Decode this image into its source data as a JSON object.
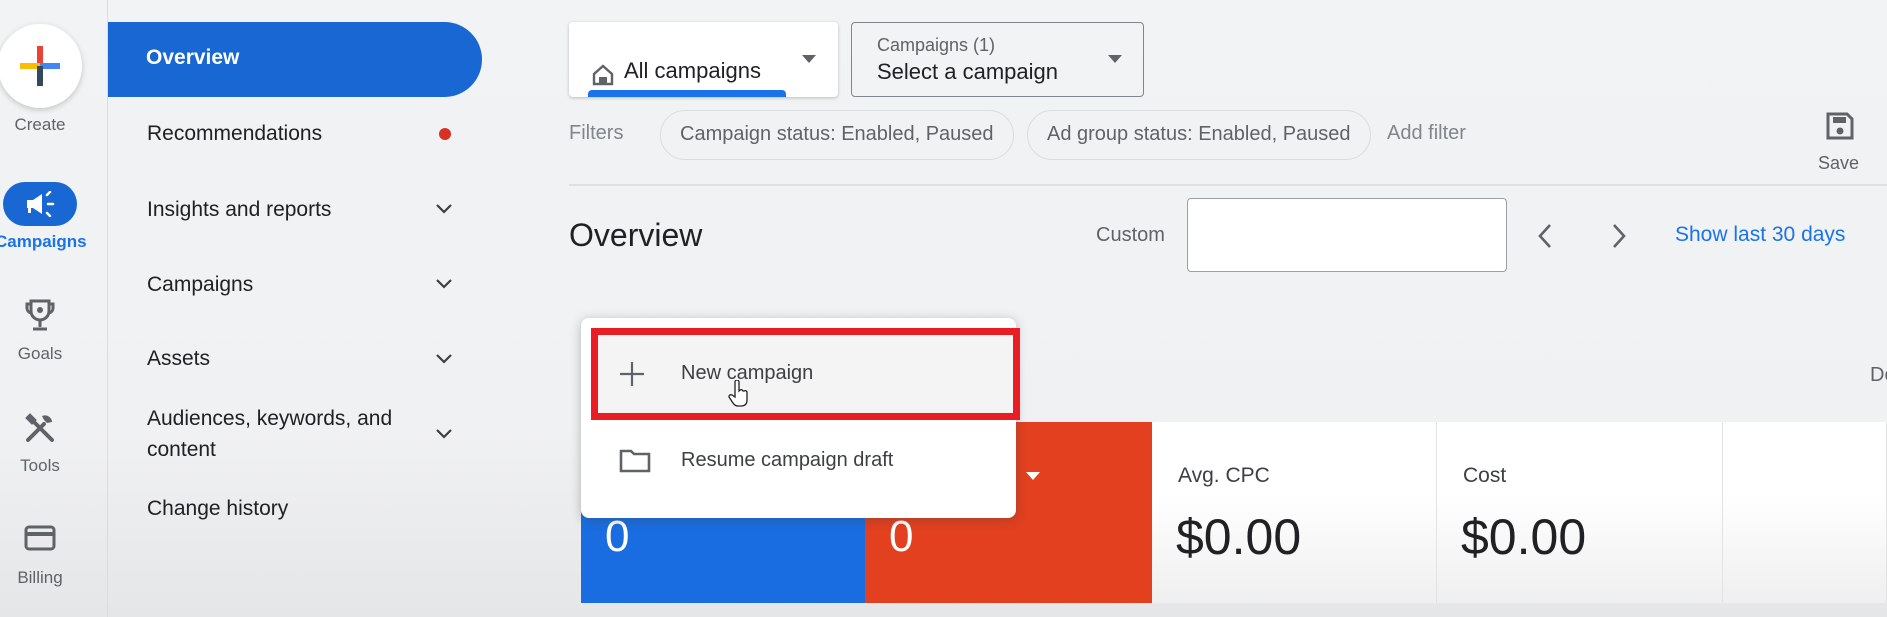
{
  "rail": {
    "create_label": "Create",
    "items": [
      {
        "label": "Campaigns",
        "icon": "megaphone-icon",
        "active": true
      },
      {
        "label": "Goals",
        "icon": "trophy-icon"
      },
      {
        "label": "Tools",
        "icon": "tools-icon"
      },
      {
        "label": "Billing",
        "icon": "credit-card-icon"
      }
    ]
  },
  "nav": {
    "items": [
      {
        "label": "Overview",
        "active": true
      },
      {
        "label": "Recommendations",
        "badge": "red-dot"
      },
      {
        "label": "Insights and reports",
        "expandable": true
      },
      {
        "label": "Campaigns",
        "expandable": true
      },
      {
        "label": "Assets",
        "expandable": true
      },
      {
        "label": "Audiences, keywords, and",
        "label_line2": "content",
        "expandable": true
      },
      {
        "label": "Change history"
      }
    ]
  },
  "header": {
    "scope_selector": {
      "label": "All campaigns",
      "icon": "home-icon"
    },
    "campaign_selector": {
      "caption": "Campaigns (1)",
      "value": "Select a campaign"
    },
    "filters_label": "Filters",
    "filter_chips": [
      "Campaign status: Enabled, Paused",
      "Ad group status: Enabled, Paused"
    ],
    "add_filter": "Add filter",
    "save_label": "Save"
  },
  "overview": {
    "title": "Overview",
    "date_range_label": "Custom",
    "date_input_value": "",
    "show_last_link": "Show last 30 days",
    "truncated_right_text": "Do"
  },
  "menu": {
    "items": [
      {
        "label": "New campaign",
        "icon": "plus-icon",
        "highlighted": true
      },
      {
        "label": "Resume campaign draft",
        "icon": "folder-icon"
      }
    ]
  },
  "cards": [
    {
      "value": "0",
      "color": "#1a6de0"
    },
    {
      "value": "0",
      "color": "#e2401f"
    },
    {
      "label": "Avg. CPC",
      "value": "$0.00"
    },
    {
      "label": "Cost",
      "value": "$0.00"
    }
  ],
  "colors": {
    "accent": "#1967d2",
    "highlight_box": "#ea1c24",
    "link": "#1a73e8"
  }
}
